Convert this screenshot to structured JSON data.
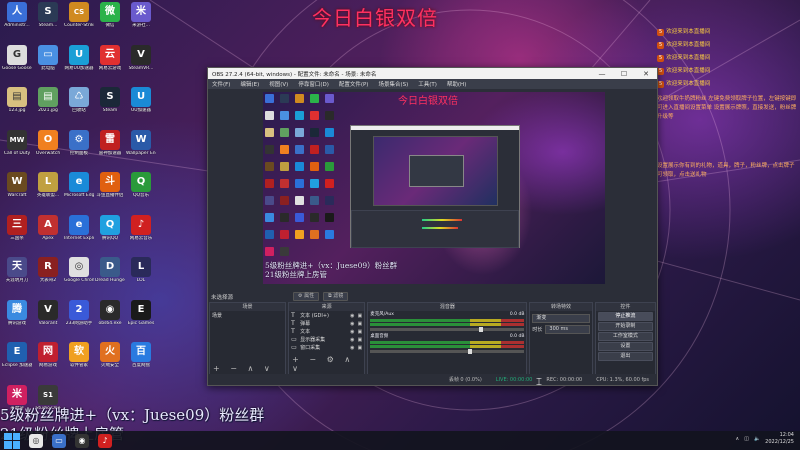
{
  "wallpaper_title": "今日白银双倍",
  "desktop_icons": [
    {
      "label": "Administr...",
      "color": "#3a6fd8",
      "glyph": "人"
    },
    {
      "label": "Steam...",
      "color": "#2b3a55",
      "glyph": "S"
    },
    {
      "label": "Counter-Strike...",
      "color": "#d08a20",
      "glyph": "CS"
    },
    {
      "label": "微信",
      "color": "#2bb24a",
      "glyph": "微"
    },
    {
      "label": "米游社...",
      "color": "#6a5acd",
      "glyph": "米"
    },
    {
      "label": "Goose Goose Duck",
      "color": "#ddd",
      "glyph": "G"
    },
    {
      "label": "此电脑",
      "color": "#4a90e2",
      "glyph": "▭"
    },
    {
      "label": "网易UU加速器",
      "color": "#1a9fd6",
      "glyph": "U"
    },
    {
      "label": "网易云游戏",
      "color": "#e03030",
      "glyph": "云"
    },
    {
      "label": "SteamVR...",
      "color": "#2a2a2a",
      "glyph": "V"
    },
    {
      "label": "123.jpg",
      "color": "#d8c080",
      "glyph": "▤"
    },
    {
      "label": "2021.jpg",
      "color": "#60a060",
      "glyph": "▤"
    },
    {
      "label": "回收站",
      "color": "#7aa8d8",
      "glyph": "♺"
    },
    {
      "label": "Steam",
      "color": "#1b2838",
      "glyph": "S"
    },
    {
      "label": "UU加速器",
      "color": "#1a8ad6",
      "glyph": "U"
    },
    {
      "label": "Call of Duty",
      "color": "#333",
      "glyph": "MW"
    },
    {
      "label": "Overwatch",
      "color": "#f08020",
      "glyph": "O"
    },
    {
      "label": "控制面板",
      "color": "#3a70c8",
      "glyph": "⚙"
    },
    {
      "label": "雷神加速器",
      "color": "#c02020",
      "glyph": "雷"
    },
    {
      "label": "Wallpaper Engine",
      "color": "#2a5aa8",
      "glyph": "W"
    },
    {
      "label": "Warcraft",
      "color": "#6a4a20",
      "glyph": "W"
    },
    {
      "label": "英雄联盟...",
      "color": "#c0a040",
      "glyph": "L"
    },
    {
      "label": "Microsoft Edge",
      "color": "#1a8ad8",
      "glyph": "e"
    },
    {
      "label": "斗鱼直播伴侣",
      "color": "#e06010",
      "glyph": "斗"
    },
    {
      "label": "QQ音乐",
      "color": "#2a9a3a",
      "glyph": "Q"
    },
    {
      "label": "三国杀",
      "color": "#b02020",
      "glyph": "三"
    },
    {
      "label": "Apex",
      "color": "#c03030",
      "glyph": "A"
    },
    {
      "label": "Internet Explorer",
      "color": "#2a70d8",
      "glyph": "e"
    },
    {
      "label": "腾讯QQ",
      "color": "#20a0e0",
      "glyph": "Q"
    },
    {
      "label": "网易云音乐",
      "color": "#d02020",
      "glyph": "♪"
    },
    {
      "label": "天涯明月刀",
      "color": "#4a4a8a",
      "glyph": "天"
    },
    {
      "label": "大表哥2",
      "color": "#8a2020",
      "glyph": "R"
    },
    {
      "label": "Google Chrome",
      "color": "#e0e0e0",
      "glyph": "◎"
    },
    {
      "label": "Dread Hunger",
      "color": "#3a5a8a",
      "glyph": "D"
    },
    {
      "label": "LOL",
      "color": "#2a2a5a",
      "glyph": "L"
    },
    {
      "label": "腾讯游戏",
      "color": "#3a8ae0",
      "glyph": "腾"
    },
    {
      "label": "Valorant",
      "color": "#2a2a2a",
      "glyph": "V"
    },
    {
      "label": "233网游助手",
      "color": "#3a5ad8",
      "glyph": "2"
    },
    {
      "label": "obs64.exe",
      "color": "#2a2a2a",
      "glyph": "◉"
    },
    {
      "label": "Epic Games",
      "color": "#1a1a1a",
      "glyph": "E"
    },
    {
      "label": "Eclipse 加速器",
      "color": "#2060b0",
      "glyph": "E"
    },
    {
      "label": "网易游戏",
      "color": "#c02030",
      "glyph": "网"
    },
    {
      "label": "软件管家",
      "color": "#f0a020",
      "glyph": "软"
    },
    {
      "label": "火绒安全",
      "color": "#e07020",
      "glyph": "火"
    },
    {
      "label": "百度网盘",
      "color": "#2a7ae0",
      "glyph": "百"
    },
    {
      "label": "米哈游",
      "color": "#d02060",
      "glyph": "米"
    },
    {
      "label": "Studio One",
      "color": "#3a3a3a",
      "glyph": "S1"
    }
  ],
  "chat": {
    "messages": [
      {
        "badge": "5",
        "text": "欢迎来到本直播间"
      },
      {
        "badge": "5",
        "text": "欢迎来到本直播间"
      },
      {
        "badge": "5",
        "text": "欢迎来到本直播间"
      },
      {
        "badge": "5",
        "text": "欢迎来到本直播间"
      },
      {
        "badge": "5",
        "text": "欢迎来到本直播间"
      }
    ],
    "note1": "欢迎领取牛奶牌粉丝 左键免费领取牌子位置，左键按键即可进入直播间设置菜单 设置展示牌照，直接发送，粉丝牌升级等",
    "note2": "设置展示你有到的礼物，道具，牌子，粉丝牌，点击牌子可领取，点击送礼物"
  },
  "overlay_text": {
    "line1": "5级粉丝牌进+（vx：Juese09）粉丝群",
    "line2": "21级粉丝牌上房管"
  },
  "obs": {
    "title": "OBS 27.2.4 (64-bit, windows) - 配置文件: 未命名 - 场景: 未命名",
    "window_buttons": [
      "—",
      "☐",
      "✕"
    ],
    "menu": [
      "文件(F)",
      "编辑(E)",
      "视图(V)",
      "停靠窗口(D)",
      "配置文件(P)",
      "场景集合(S)",
      "工具(T)",
      "帮助(H)"
    ],
    "no_scene_label": "未选择源",
    "scene_tabs": [
      "⚙ 属性",
      "⧉ 滤镜"
    ],
    "preview_title": "今日白银双倍",
    "preview_overlay_1": "5级粉丝牌进+（vx：Juese09）粉丝群",
    "preview_overlay_2": "21级粉丝牌上房管",
    "docks": {
      "scenes": {
        "title": "场景",
        "items": [
          "场景"
        ],
        "footer": "+ − ∧ ∨"
      },
      "sources": {
        "title": "来源",
        "items": [
          {
            "icon": "T",
            "name": "文本 (GDI+)"
          },
          {
            "icon": "T",
            "name": "弹幕"
          },
          {
            "icon": "T",
            "name": "文本"
          },
          {
            "icon": "▭",
            "name": "显示器采集"
          },
          {
            "icon": "▭",
            "name": "窗口采集"
          }
        ],
        "footer": "+ − ⚙ ∧ ∨"
      },
      "mixer": {
        "title": "混音器",
        "channels": [
          {
            "name": "麦克风/Aux",
            "db": "0.0 dB",
            "level": 0.72
          },
          {
            "name": "桌面音频",
            "db": "0.0 dB",
            "level": 0.65
          }
        ]
      },
      "transitions": {
        "title": "转场特效",
        "type": "渐变",
        "duration_label": "时长",
        "duration": "300 ms"
      },
      "controls": {
        "title": "控件",
        "buttons": [
          "停止推流",
          "开始录制",
          "工作室模式",
          "设置",
          "退出"
        ]
      }
    },
    "status": {
      "dropped": "丢帧 0 (0.0%)",
      "live": "LIVE: 00:00:00",
      "rec": "REC: 00:00:00",
      "cpu": "CPU: 1.3%, 60.00 fps"
    }
  },
  "taskbar": {
    "apps": [
      {
        "glyph": "◎",
        "color": "#e8e8e8",
        "name": "chrome"
      },
      {
        "glyph": "▭",
        "color": "#3a70c8",
        "name": "explorer"
      },
      {
        "glyph": "◉",
        "color": "#333",
        "name": "obs"
      },
      {
        "glyph": "♪",
        "color": "#d02020",
        "name": "netease-music"
      }
    ],
    "time": "12:04",
    "date": "2022/12/25"
  }
}
